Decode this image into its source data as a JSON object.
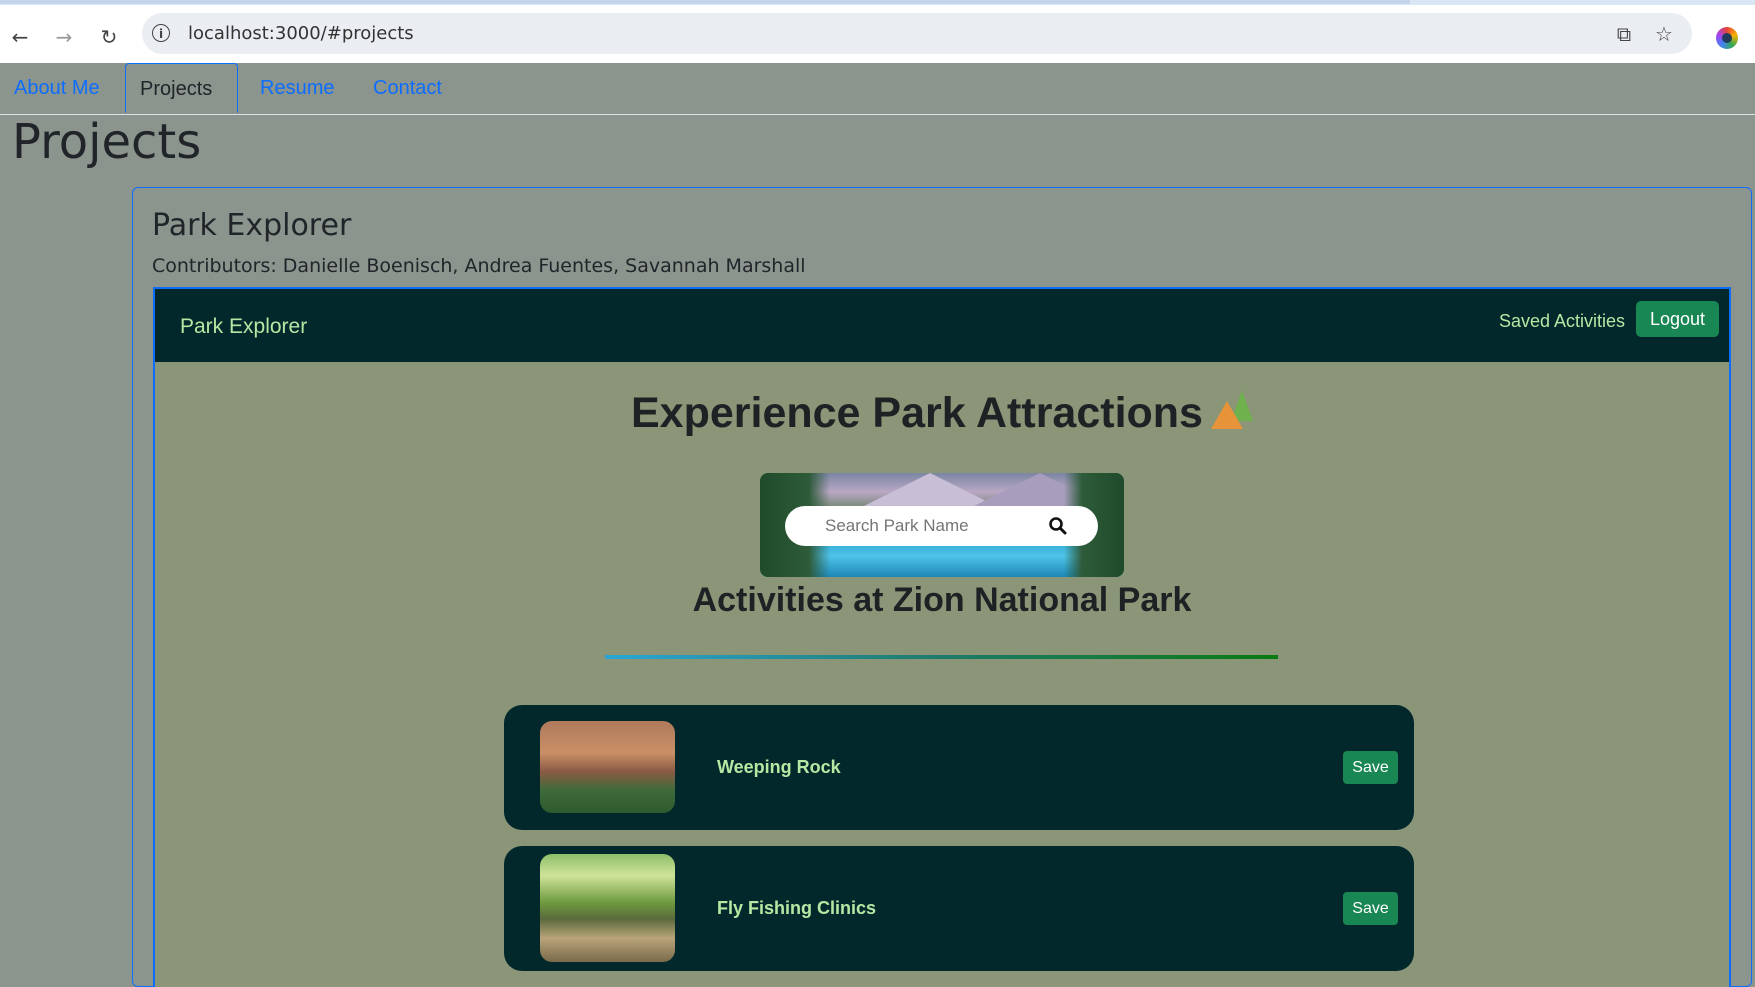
{
  "browser": {
    "url": "localhost:3000/#projects",
    "icons": [
      "back-icon",
      "forward-icon",
      "reload-icon",
      "site-info-icon",
      "open-in-new-window-icon",
      "bookmark-star-icon",
      "profile-icon"
    ]
  },
  "site": {
    "tabs": [
      {
        "label": "About Me",
        "active": false
      },
      {
        "label": "Projects",
        "active": true
      },
      {
        "label": "Resume",
        "active": false
      },
      {
        "label": "Contact",
        "active": false
      }
    ],
    "page_title": "Projects"
  },
  "project": {
    "name": "Park Explorer",
    "contributors": "Contributors: Danielle Boenisch, Andrea Fuentes, Savannah Marshall"
  },
  "app": {
    "brand": "Park Explorer",
    "saved_link": "Saved Activities",
    "logout_label": "Logout",
    "hero_title": "Experience Park Attractions",
    "hero_emoji": "camping-icon",
    "search": {
      "placeholder": "Search Park Name",
      "value": ""
    },
    "activities_title": "Activities at Zion National Park",
    "activities": [
      {
        "name": "Weeping Rock",
        "save_label": "Save",
        "image": "weeping-rock-photo"
      },
      {
        "name": "Fly Fishing Clinics",
        "save_label": "Save",
        "image": "fly-fishing-photo"
      }
    ],
    "colors": {
      "nav_bg": "#03282b",
      "accent_green": "#b6e8a4",
      "button_green": "#198754",
      "page_bg": "#8a9677",
      "link_blue": "#0d6efd"
    }
  }
}
